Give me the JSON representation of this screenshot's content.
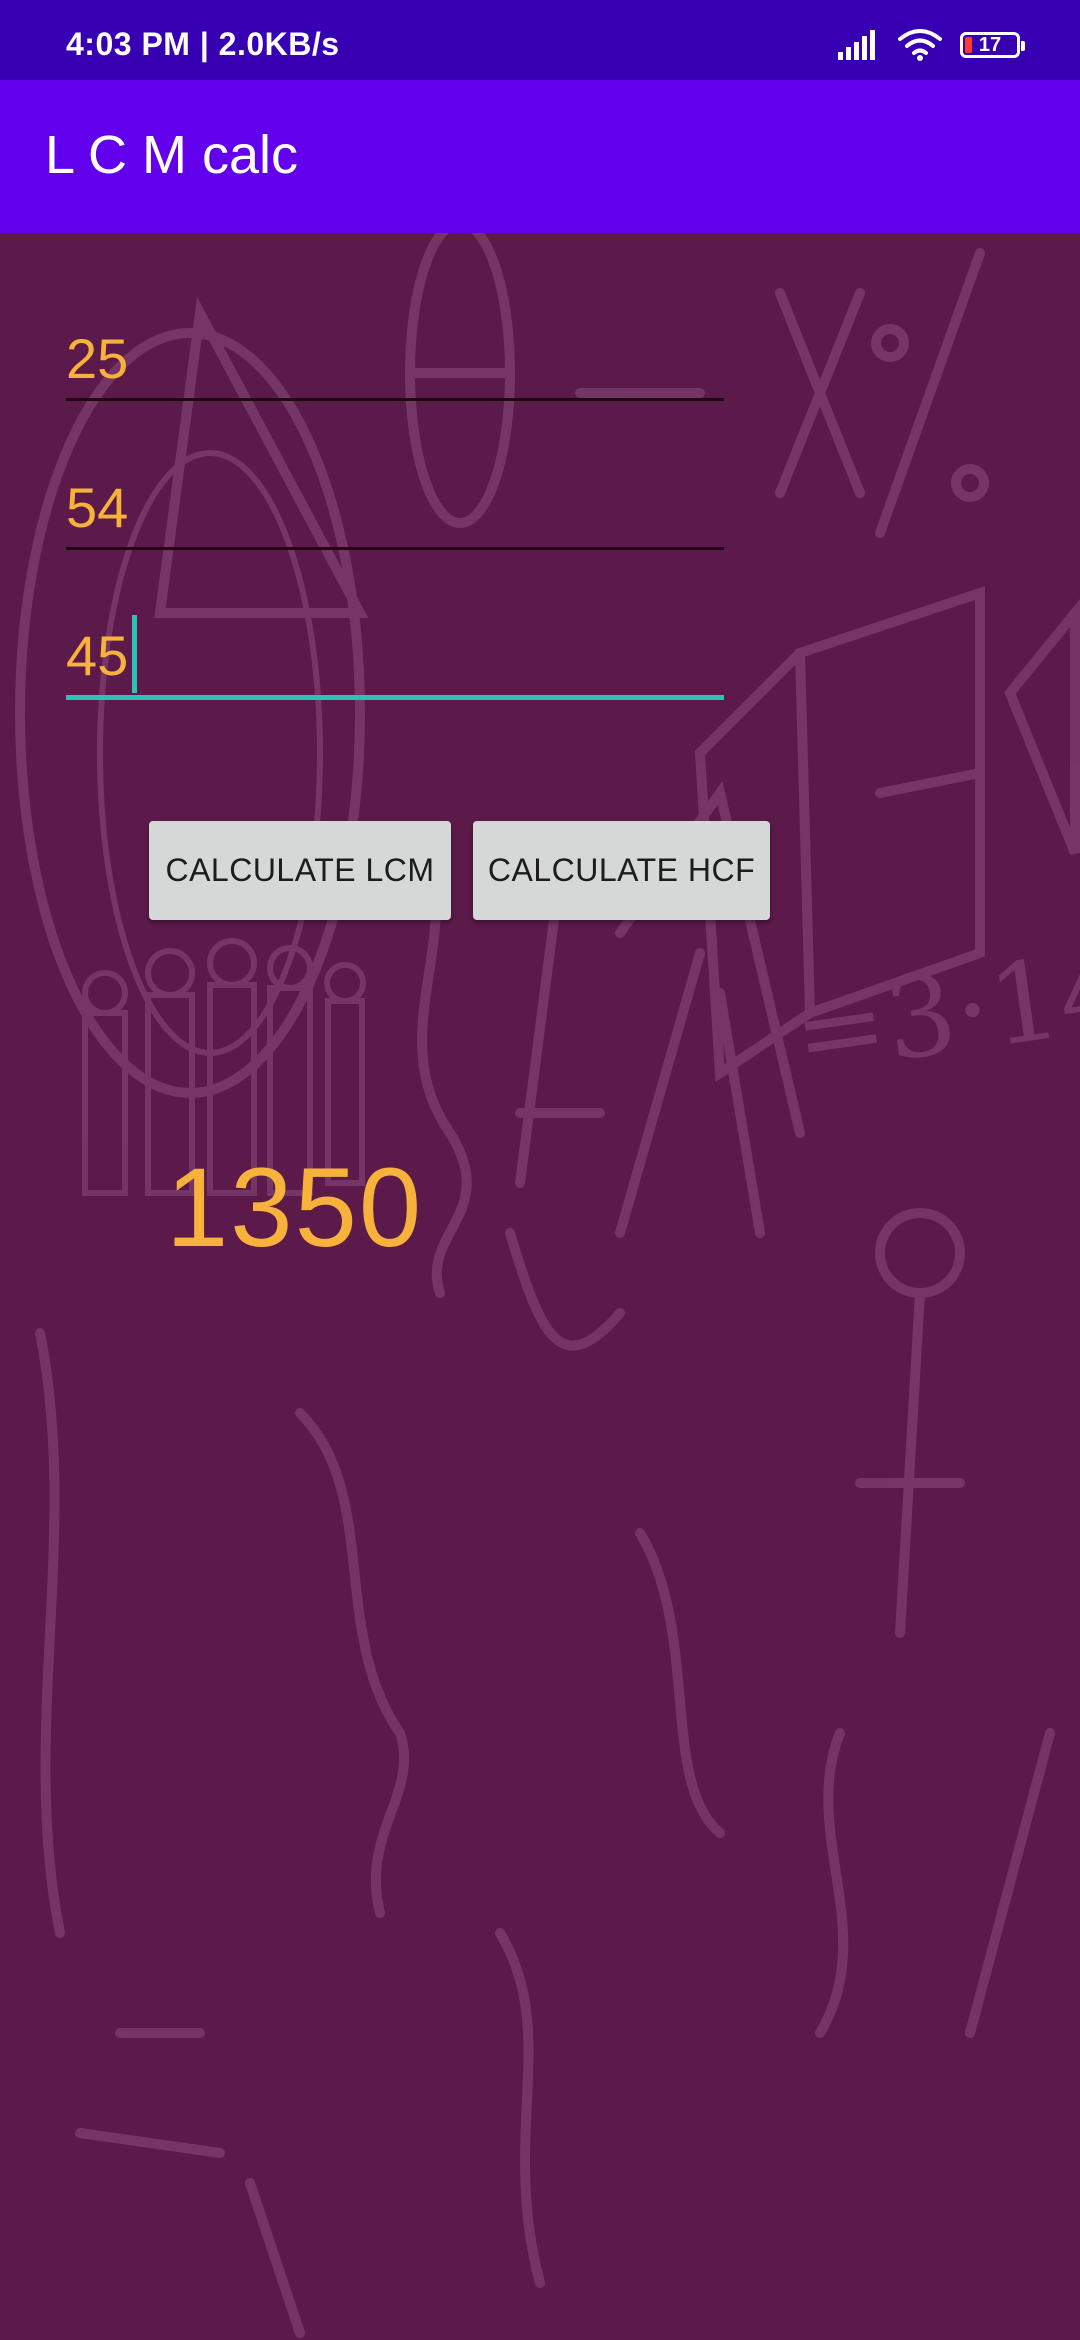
{
  "status_bar": {
    "time": "4:03 PM | 2.0KB/s",
    "battery": "17",
    "signal_icon": "signal-icon",
    "wifi_icon": "wifi-icon",
    "battery_icon": "battery-icon"
  },
  "app_bar": {
    "title": "L C M calc",
    "color": "#6200ee"
  },
  "inputs": [
    {
      "value": "25",
      "focused": false
    },
    {
      "value": "54",
      "focused": false
    },
    {
      "value": "45",
      "focused": true
    }
  ],
  "buttons": {
    "lcm_label": "CALCULATE LCM",
    "hcf_label": "CALCULATE HCF"
  },
  "result": "1350",
  "colors": {
    "background": "#5c1a4a",
    "status_bar": "#3700b3",
    "text_accent": "#f7b23b",
    "focus_accent": "#2ac3b5"
  }
}
